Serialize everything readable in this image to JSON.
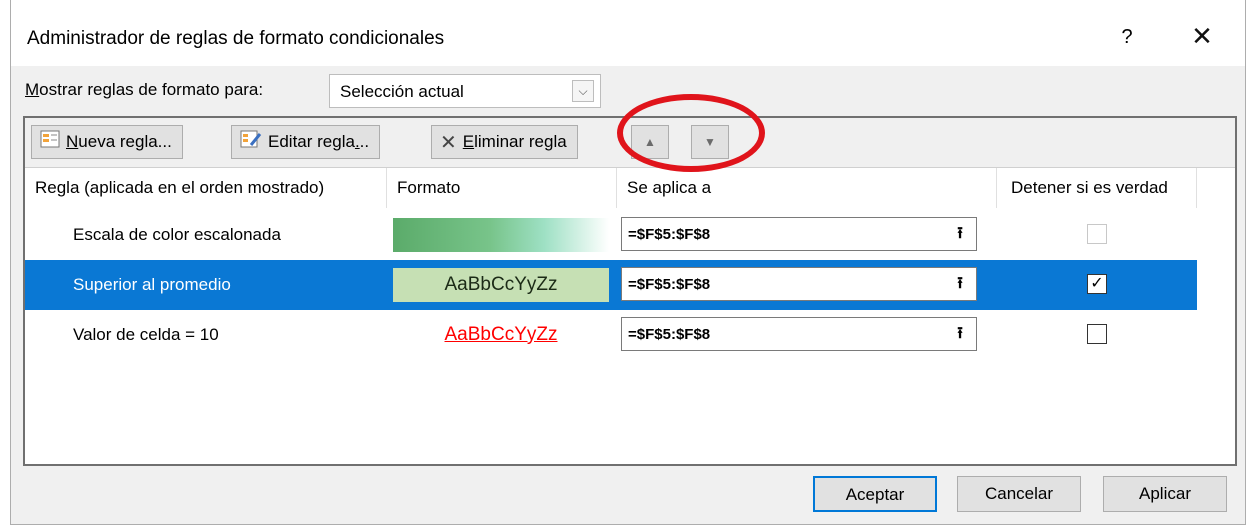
{
  "window": {
    "title": "Administrador de reglas de formato condicionales",
    "help_label": "?",
    "close_label": "✕"
  },
  "show_rules": {
    "label_underlined": "M",
    "label_rest": "ostrar reglas de formato para:",
    "selected_value": "Selección actual",
    "arrow": "⌵"
  },
  "toolbar": {
    "new_rule_underlined": "N",
    "new_rule_rest": "ueva regla...",
    "edit_rule_before": "Editar regla",
    "edit_rule_underlined": ".",
    "edit_rule_after": "..",
    "delete_rule_icon": "✕",
    "delete_rule_underlined": "E",
    "delete_rule_rest": "liminar regla",
    "move_up": "▲",
    "move_down": "▼"
  },
  "columns": {
    "rule": "Regla (aplicada en el orden mostrado)",
    "format": "Formato",
    "applies_to": "Se aplica a",
    "stop_if_true": "Detener si es verdad"
  },
  "rules": [
    {
      "name": "Escala de color escalonada",
      "format_preview": "",
      "applies_to": "=$F$5:$F$8",
      "stop_if_true": false,
      "stop_enabled": false
    },
    {
      "name": "Superior al promedio",
      "format_preview": "AaBbCcYyZz",
      "applies_to": "=$F$5:$F$8",
      "stop_if_true": true,
      "stop_enabled": true
    },
    {
      "name": "Valor de celda = 10",
      "format_preview": "AaBbCcYyZz",
      "applies_to": "=$F$5:$F$8",
      "stop_if_true": false,
      "stop_enabled": true
    }
  ],
  "collapse_icon": "⭱",
  "check_mark": "✓",
  "buttons": {
    "ok": "Aceptar",
    "cancel": "Cancelar",
    "apply": "Aplicar"
  },
  "colors": {
    "selection": "#0a78d4",
    "annotation": "#e0141b",
    "format_green": "#c6e0b4",
    "format_red": "#ff0000"
  }
}
